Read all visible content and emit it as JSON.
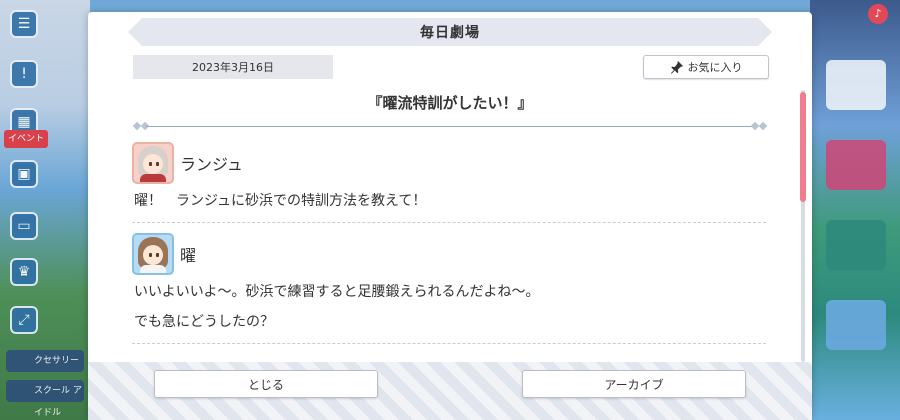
{
  "dialog": {
    "title": "毎日劇場",
    "date": "2023年3月16日",
    "favorite_label": "お気に入り",
    "episode_title": "『曜流特訓がしたい！』"
  },
  "messages": [
    {
      "speaker": "ランジュ",
      "avatar": "ranju-avatar",
      "lines": [
        "曜！　ランジュに砂浜での特訓方法を教えて！"
      ]
    },
    {
      "speaker": "曜",
      "avatar": "you-avatar",
      "lines": [
        "いいよいいよ〜。砂浜で練習すると足腰鍛えられるんだよね〜。",
        "でも急にどうしたの？"
      ]
    }
  ],
  "footer": {
    "close_label": "とじる",
    "archive_label": "アーカイブ"
  },
  "colors": {
    "scroll_thumb": "#ef7d8e",
    "title_bar": "#e4e7ef",
    "date_bg": "#e6e7ec"
  },
  "background": {
    "event_label": "イベント",
    "closet_label": "クセサリー",
    "school_idol_label": "スクール\nアイドル"
  }
}
